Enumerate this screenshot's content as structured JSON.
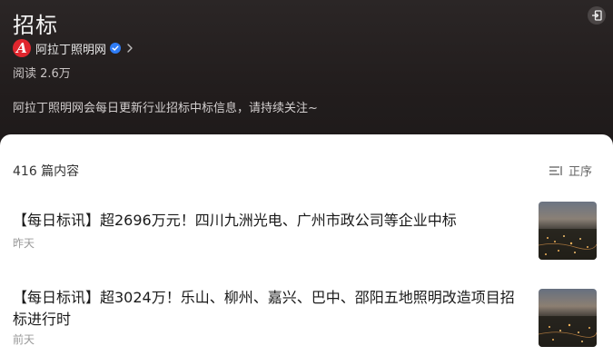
{
  "header": {
    "title": "招标",
    "author": {
      "logo_letter": "A",
      "name": "阿拉丁照明网",
      "verified_icon": "verified-icon",
      "chevron_icon": "chevron-right-icon"
    },
    "reads": "阅读 2.6万",
    "description": "阿拉丁照明网会每日更新行业招标中标信息，请持续关注~",
    "exit_icon": "exit-icon"
  },
  "content": {
    "count": "416 篇内容",
    "sort_label": "正序",
    "sort_icon": "sort-icon",
    "articles": [
      {
        "title": "【每日标讯】超2696万元！四川九洲光电、广州市政公司等企业中标",
        "date": "昨天"
      },
      {
        "title": "【每日标讯】超3024万！乐山、柳州、嘉兴、巴中、邵阳五地照明改造项目招标进行时",
        "date": "前天"
      }
    ]
  },
  "colors": {
    "header_bg": "#221d1d",
    "logo_red": "#e0262e",
    "verified_blue": "#2e7cf6"
  }
}
